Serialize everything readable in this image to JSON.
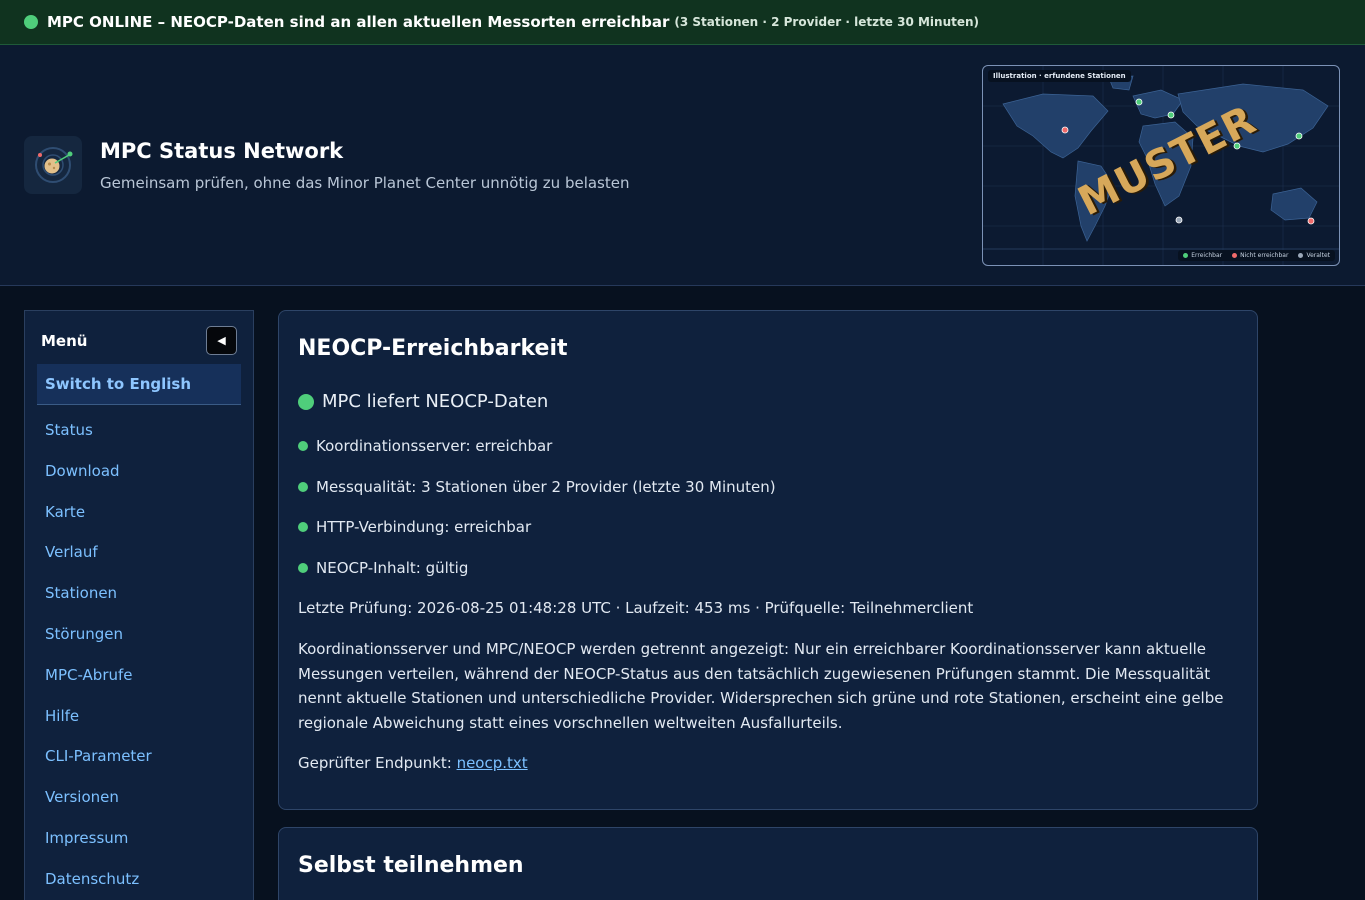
{
  "banner": {
    "main": "MPC ONLINE – NEOCP-Daten sind an allen aktuellen Messorten erreichbar",
    "sub": "(3 Stationen · 2 Provider · letzte 30 Minuten)"
  },
  "header": {
    "title": "MPC Status Network",
    "subtitle": "Gemeinsam prüfen, ohne das Minor Planet Center unnötig zu belasten",
    "map": {
      "tag": "Illustration · erfundene Stationen",
      "watermark": "MUSTER",
      "legend": [
        {
          "label": "Erreichbar",
          "color": "#4fce7b"
        },
        {
          "label": "Nicht erreichbar",
          "color": "#f06a6a"
        },
        {
          "label": "Veraltet",
          "color": "#9aa7b8"
        }
      ]
    }
  },
  "sidebar": {
    "title": "Menü",
    "collapse_icon": "◀",
    "language": "Switch to English",
    "items": [
      "Status",
      "Download",
      "Karte",
      "Verlauf",
      "Stationen",
      "Störungen",
      "MPC-Abrufe",
      "Hilfe",
      "CLI-Parameter",
      "Versionen",
      "Impressum",
      "Datenschutz"
    ]
  },
  "main": {
    "title": "NEOCP-Erreichbarkeit",
    "status": "MPC liefert NEOCP-Daten",
    "checks": [
      "Koordinationsserver: erreichbar",
      "Messqualität: 3 Stationen über 2 Provider (letzte 30 Minuten)",
      "HTTP-Verbindung: erreichbar",
      "NEOCP-Inhalt: gültig"
    ],
    "meta": "Letzte Prüfung: 2026-08-25 01:48:28 UTC · Laufzeit: 453 ms · Prüfquelle: Teilnehmerclient",
    "description": "Koordinationsserver und MPC/NEOCP werden getrennt angezeigt: Nur ein erreichbarer Koordinationsserver kann aktuelle Messungen verteilen, während der NEOCP-Status aus den tatsächlich zugewiesenen Prüfungen stammt. Die Messqualität nennt aktuelle Stationen und unterschiedliche Provider. Widersprechen sich grüne und rote Stationen, erscheint eine gelbe regionale Abweichung statt eines vorschnellen weltweiten Ausfallurteils.",
    "endpoint_label": "Geprüfter Endpunkt:",
    "endpoint_link": "neocp.txt"
  },
  "second_card": {
    "title": "Selbst teilnehmen"
  },
  "colors": {
    "online": "#4fce7b",
    "offline": "#f06a6a",
    "stale": "#9aa7b8",
    "link": "#7cc0ff"
  }
}
